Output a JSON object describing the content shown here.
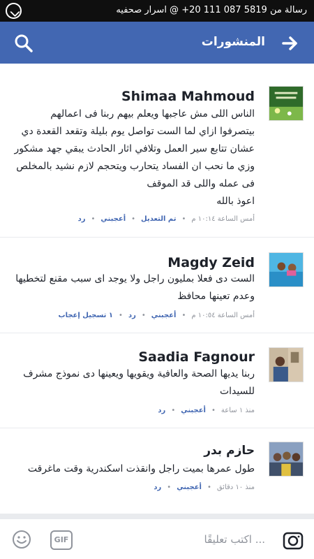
{
  "status_bar": {
    "banner": "رسالة من 5819 087 111 20+ @ اسرار صحفيه",
    "whatsapp_icon": "whatsapp-icon"
  },
  "header": {
    "title": "المنشورات",
    "back_icon": "arrow-right-icon",
    "search_icon": "search-icon",
    "background": "#4267b2"
  },
  "comments": [
    {
      "author": "Shimaa Mahmoud",
      "text": "الناس اللى مش عاجبها ويعلم بيهم ربنا فى اعمالهم بيتصرفوا ازاي لما الست تواصل يوم بليلة وتقعد القعدة دي عشان تتابع سير العمل وتلافي اثار الحادث يبقي جهد مشكور وزي ما نحب ان الفساد يتحارب ويتحجم لازم نشيد بالمخلص فى عمله واللى قد الموقف\nاعوذ بالله",
      "time": "أمس الساعة ١٠:١٤ م",
      "actions": [
        "تم التعديل",
        "أعجبني",
        "رد"
      ]
    },
    {
      "author": "Magdy Zeid",
      "text": "الست دى فعلا بمليون راجل ولا يوجد اى سبب مقنع لتخطيها وعدم تعينها محافظ",
      "time": "أمس الساعة ١٠:٥٤ م",
      "actions": [
        "أعجبني",
        "رد",
        "١ تسجيل إعجاب"
      ]
    },
    {
      "author": "Saadia Fagnour",
      "text": "ربنا يديها الصحة والعافية ويقويها ويعينها دى نموذج مشرف للسيدات",
      "time": "منذ ١ ساعة",
      "actions": [
        "أعجبني",
        "رد"
      ]
    },
    {
      "author": "حازم بدر",
      "text": "طول عمرها بميت راجل وانقذت اسكندرية وقت ماغرقت",
      "time": "منذ ١٠ دقائق",
      "actions": [
        "أعجبني",
        "رد"
      ]
    }
  ],
  "composer": {
    "placeholder": "اكتب تعليقًا ...",
    "gif_label": "GIF",
    "camera_icon": "camera-icon",
    "emoji_icon": "emoji-icon"
  }
}
